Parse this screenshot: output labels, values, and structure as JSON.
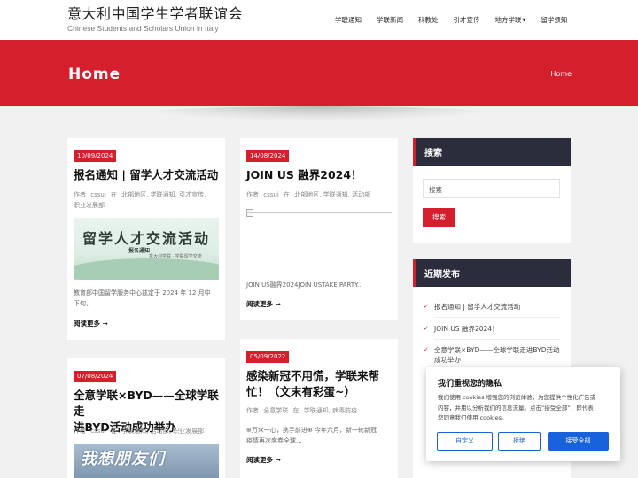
{
  "header": {
    "title": "意大利中国学生学者联谊会",
    "subtitle": "Chinese Students and Scholars Union in Italy",
    "nav": [
      "学联通知",
      "学联新闻",
      "科教处",
      "引才宣传",
      "地方学联",
      "留学须知"
    ]
  },
  "hero": {
    "title": "Home",
    "breadcrumb": "Home"
  },
  "posts": [
    {
      "date": "10/09/2024",
      "title": "报名通知 | 留学人才交流活动",
      "meta_author_label": "作者",
      "meta_author": "cssui",
      "meta_in_label": "在",
      "meta_categories_line1": "北部地区, 学联通知, 引才宣传,",
      "meta_categories_line2": "职业发展部",
      "thumb_main": "留学人才交流活动",
      "thumb_sub": "报名通知",
      "thumb_logo": "意大利学联 · 学联留学交流",
      "excerpt_line1": "教育部中国留学服务中心兹定于 2024 年 12 月中",
      "excerpt_line2": "下旬，...",
      "readmore": "阅读更多"
    },
    {
      "date": "14/08/2024",
      "title": "JOIN US 融界2024！",
      "meta_author_label": "作者",
      "meta_author": "cssui",
      "meta_in_label": "在",
      "meta_categories_line1": "北部地区, 学联通知, 活动部",
      "excerpt_line1": "JOIN US融界2024JOIN USTAKE PARTY...",
      "readmore": "阅读更多"
    },
    {
      "date": "07/08/2024",
      "title_line1": "全意学联×BYD——全球学联走",
      "title_line2": "进BYD活动成功举办",
      "meta_author_label": "作者",
      "meta_author": "cssui",
      "meta_in_label": "在",
      "meta_categories_line1": "学联通知, 活动部, 职业发展部",
      "thumb_text": "我想朋友们"
    },
    {
      "date": "05/09/2022",
      "title_line1": "感染新冠不用慌，学联来帮",
      "title_line2": "忙！（文末有彩蛋~）",
      "meta_author_label": "作者",
      "meta_author": "全意学联",
      "meta_in_label": "在",
      "meta_categories_line1": "学联通知, 病毒防疫",
      "excerpt_line1": "⊕万众一心，携手前进⊕ 今年六月，新一轮新冠",
      "excerpt_line2": "疫情再次席卷全球...",
      "readmore": "阅读更多"
    }
  ],
  "sidebar": {
    "search_heading": "搜索",
    "search_placeholder": "搜索",
    "search_button": "搜索",
    "recent_heading": "近期发布",
    "recent": [
      "报名通知 | 留学人才交流活动",
      "JOIN US 融界2024！",
      "全意学联×BYD——全球学联走进BYD活动成功举办"
    ]
  },
  "cookie": {
    "title": "我们重视您的隐私",
    "text_line1": "我们使用 cookies 增强您的浏览体验，为您提供个性化广告或",
    "text_line2": "内容，并用以分析我们的信息流量。点击“接受全部”，即代表",
    "text_line3": "您同意我们使用 cookies。",
    "btn_custom": "自定义",
    "btn_reject": "拒绝",
    "btn_accept": "接受全部"
  },
  "colors": {
    "accent": "#d61f2c",
    "dark": "#2b2c3c",
    "cookie_blue": "#1863dc"
  }
}
